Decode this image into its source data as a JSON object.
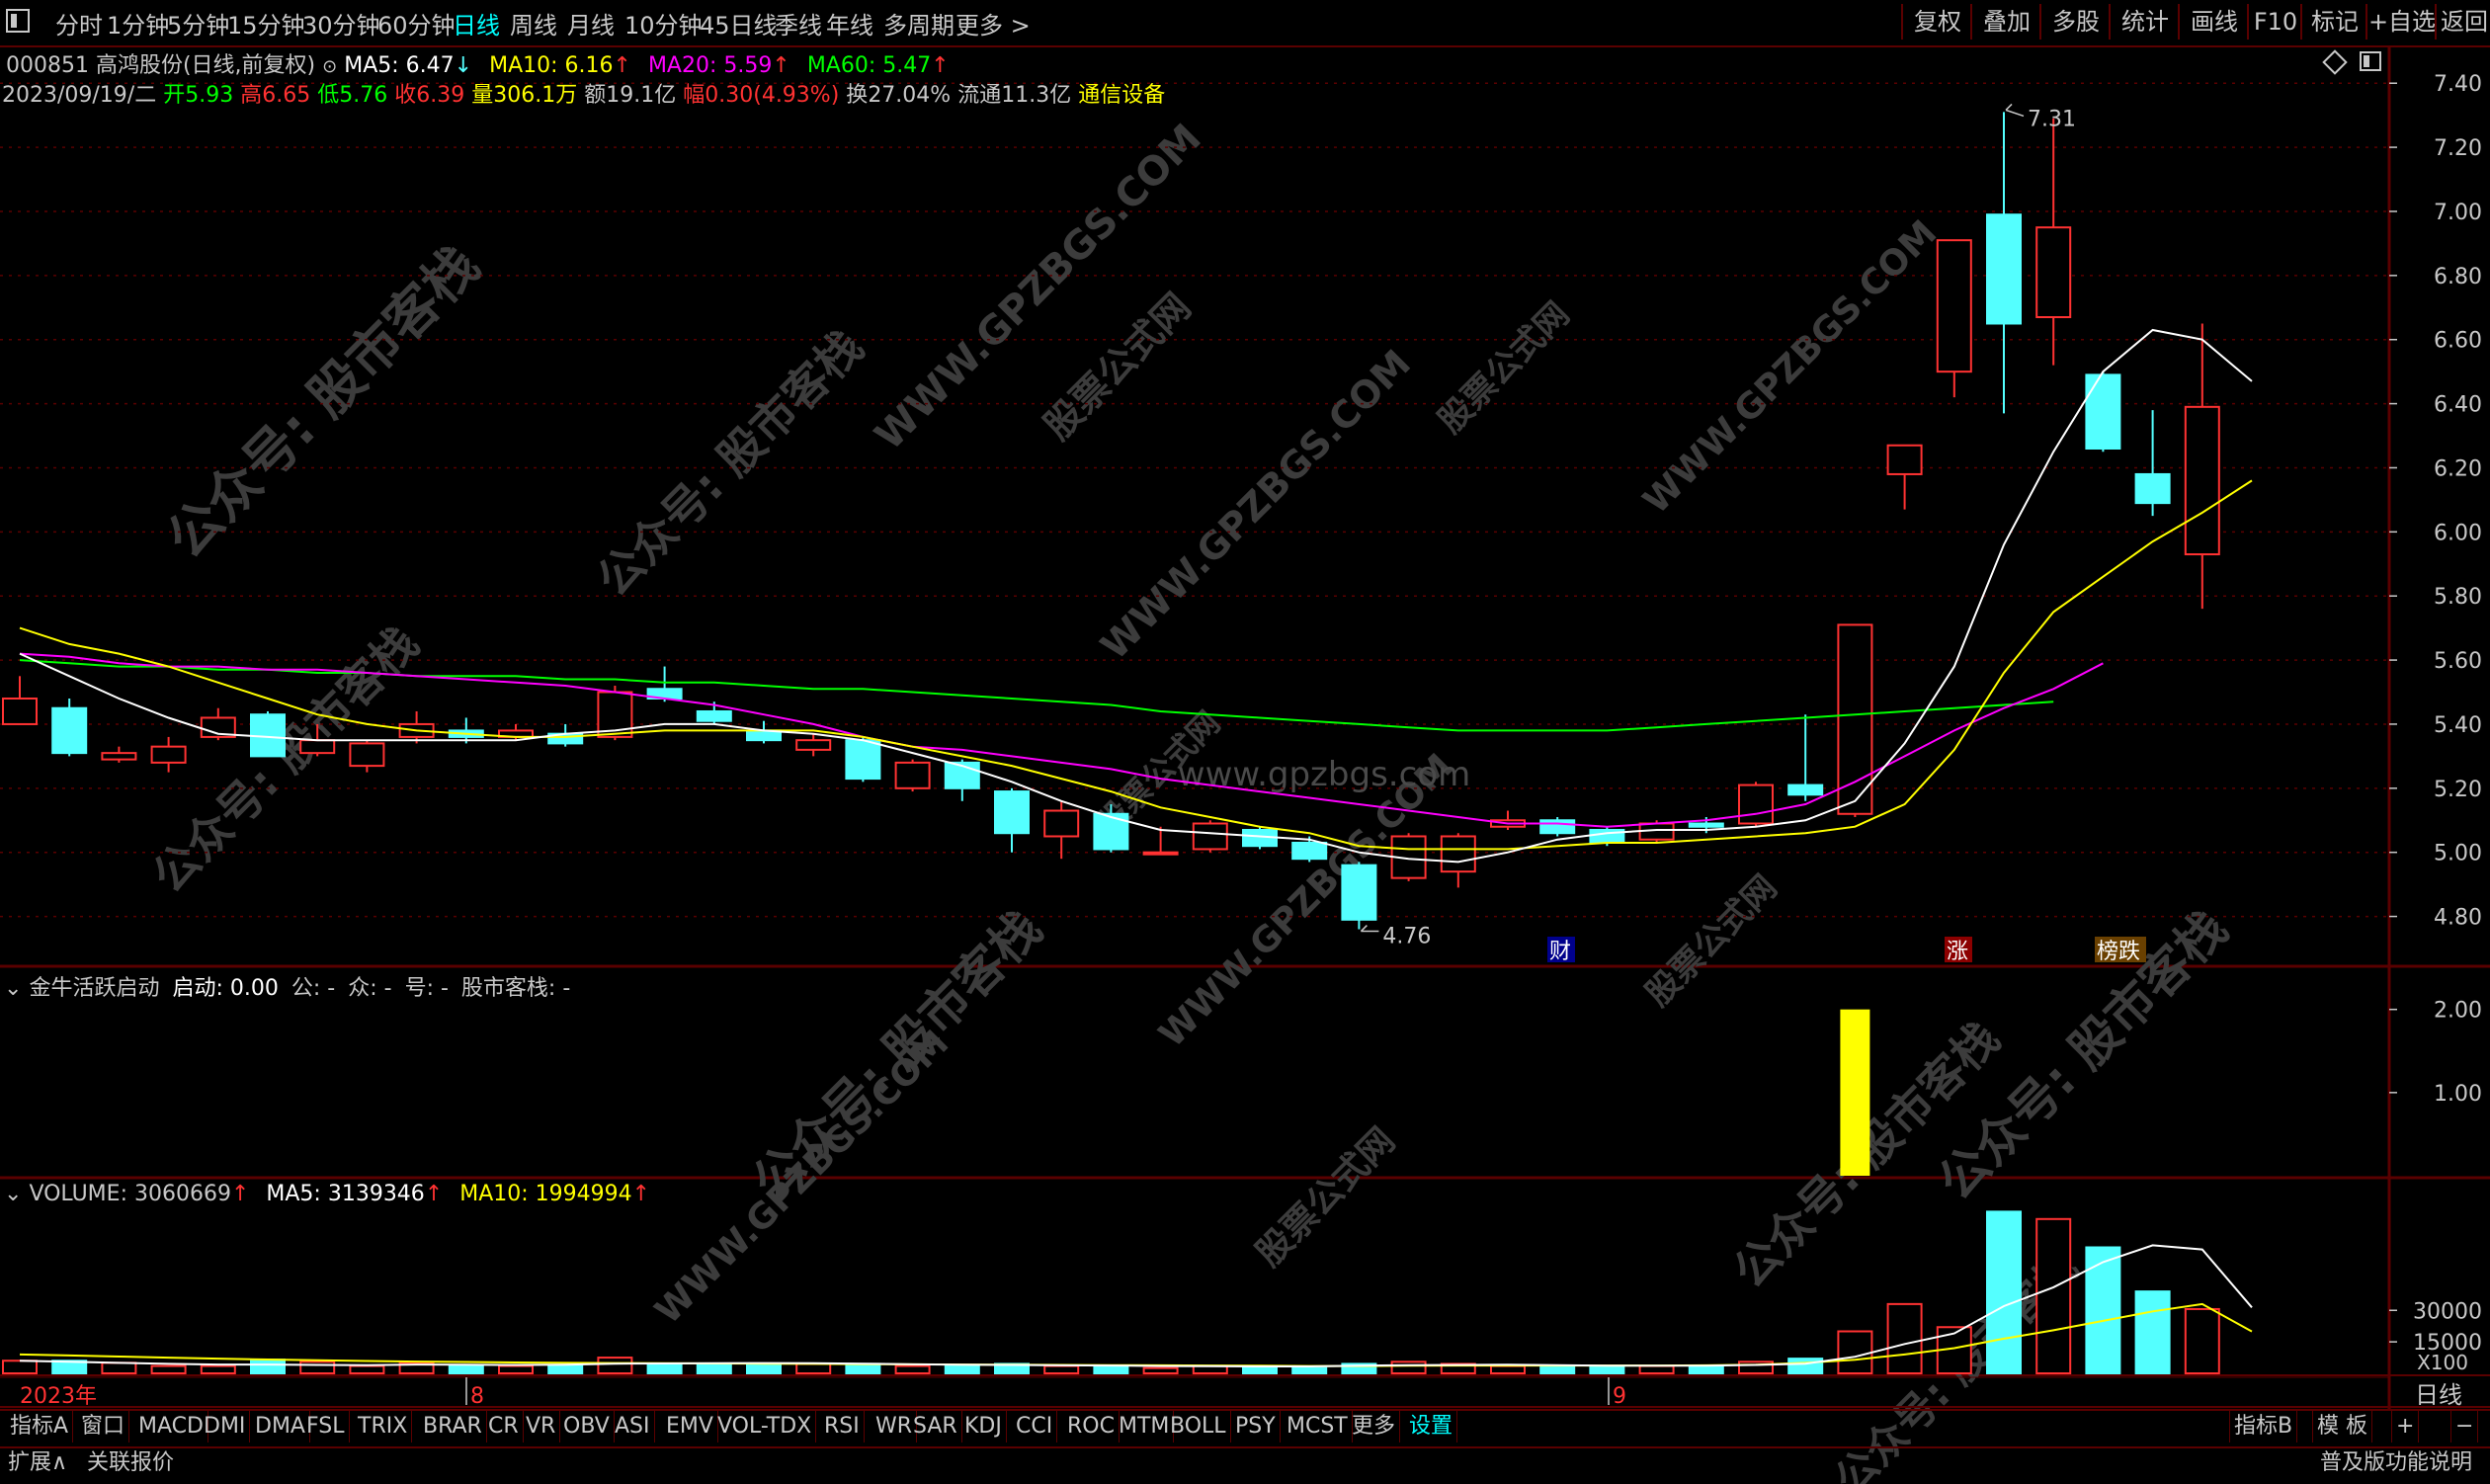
{
  "toolbar": {
    "periods": [
      "分时",
      "1分钟",
      "5分钟",
      "15分钟",
      "30分钟",
      "60分钟",
      "日线",
      "周线",
      "月线",
      "10分钟",
      "45日线",
      "季线",
      "年线",
      "多周期",
      "更多 >"
    ],
    "selected_period": "日线",
    "right_buttons": [
      "复权",
      "叠加",
      "多股",
      "统计",
      "画线",
      "F10",
      "标记",
      "+自选",
      "返回"
    ]
  },
  "header": {
    "title": "000851 高鸿股份(日线,前复权)",
    "ma5_label": "MA5: 6.47",
    "ma10_label": "MA10: 6.16",
    "ma20_label": "MA20: 5.59",
    "ma60_label": "MA60: 5.47",
    "date": "2023/09/19/二",
    "open_label": "开",
    "open": "5.93",
    "high_label": "高",
    "high": "6.65",
    "low_label": "低",
    "low": "5.76",
    "close_label": "收",
    "close": "6.39",
    "vol_label": "量",
    "vol": "306.1万",
    "amount_label": "额",
    "amount": "19.1亿",
    "range_label": "幅",
    "range": "0.30(4.93%)",
    "turnover_label": "换",
    "turnover": "27.04%",
    "float_label": "流通",
    "float": "11.3亿",
    "industry": "通信设备"
  },
  "price_axis": [
    "7.40",
    "7.20",
    "7.00",
    "6.80",
    "6.60",
    "6.40",
    "6.20",
    "6.00",
    "5.80",
    "5.60",
    "5.40",
    "5.20",
    "5.00",
    "4.80"
  ],
  "markers": {
    "high_label": "7.31",
    "low_label": "4.76",
    "m1": "财",
    "m2": "涨",
    "m3": "榜跌"
  },
  "indicator_panel": {
    "title": "金牛活跃启动",
    "field1": "启动: 0.00",
    "field2": "公: -",
    "field3": "众: -",
    "field4": "号: -",
    "field5": "股市客栈: -",
    "axis": [
      "2.00",
      "1.00"
    ]
  },
  "volume_panel": {
    "vol_label": "VOLUME: 3060669",
    "ma5_label": "MA5: 3139346",
    "ma10_label": "MA10: 1994994",
    "axis": [
      "30000",
      "15000"
    ],
    "unit": "X100"
  },
  "time_axis": {
    "labels": [
      "2023年",
      "8",
      "9"
    ],
    "right_label": "日线"
  },
  "bottom_tabs": [
    "指标A",
    "窗口",
    "MACD",
    "DMI",
    "DMA",
    "FSL",
    "TRIX",
    "BRAR",
    "CR",
    "VR",
    "OBV",
    "ASI",
    "EMV",
    "VOL-TDX",
    "RSI",
    "WR",
    "SAR",
    "KDJ",
    "CCI",
    "ROC",
    "MTM",
    "BOLL",
    "PSY",
    "MCST",
    "更多",
    "设置"
  ],
  "bottom_right": [
    "指标B",
    "模 板",
    "+",
    "−"
  ],
  "status": {
    "left1": "扩展∧",
    "left2": "关联报价",
    "right": "普及版功能说明"
  },
  "watermarks": [
    "公众号: 股市客栈",
    "WWW.GPZBGS.COM",
    "股票公式网",
    "www.gpzbgs.com"
  ],
  "colors": {
    "up": "#ff3232",
    "down": "#54ffff",
    "ma5": "#ffffff",
    "ma10": "#ffff00",
    "ma20": "#ff00ff",
    "ma60": "#00ff00",
    "grid": "#5a0000",
    "bar": "#ffff00"
  },
  "chart_data": {
    "type": "candlestick",
    "candles": [
      {
        "o": 5.4,
        "c": 5.48,
        "h": 5.55,
        "l": 5.4
      },
      {
        "o": 5.45,
        "c": 5.31,
        "h": 5.48,
        "l": 5.3
      },
      {
        "o": 5.29,
        "c": 5.31,
        "h": 5.33,
        "l": 5.28
      },
      {
        "o": 5.28,
        "c": 5.33,
        "h": 5.36,
        "l": 5.25
      },
      {
        "o": 5.36,
        "c": 5.42,
        "h": 5.45,
        "l": 5.35
      },
      {
        "o": 5.43,
        "c": 5.3,
        "h": 5.44,
        "l": 5.3
      },
      {
        "o": 5.31,
        "c": 5.35,
        "h": 5.4,
        "l": 5.3
      },
      {
        "o": 5.27,
        "c": 5.34,
        "h": 5.35,
        "l": 5.25
      },
      {
        "o": 5.36,
        "c": 5.4,
        "h": 5.44,
        "l": 5.34
      },
      {
        "o": 5.38,
        "c": 5.36,
        "h": 5.42,
        "l": 5.34
      },
      {
        "o": 5.36,
        "c": 5.38,
        "h": 5.4,
        "l": 5.35
      },
      {
        "o": 5.37,
        "c": 5.34,
        "h": 5.4,
        "l": 5.33
      },
      {
        "o": 5.36,
        "c": 5.5,
        "h": 5.52,
        "l": 5.35
      },
      {
        "o": 5.51,
        "c": 5.48,
        "h": 5.58,
        "l": 5.47
      },
      {
        "o": 5.44,
        "c": 5.41,
        "h": 5.47,
        "l": 5.4
      },
      {
        "o": 5.38,
        "c": 5.35,
        "h": 5.41,
        "l": 5.34
      },
      {
        "o": 5.32,
        "c": 5.35,
        "h": 5.37,
        "l": 5.3
      },
      {
        "o": 5.35,
        "c": 5.23,
        "h": 5.36,
        "l": 5.22
      },
      {
        "o": 5.2,
        "c": 5.28,
        "h": 5.29,
        "l": 5.19
      },
      {
        "o": 5.28,
        "c": 5.2,
        "h": 5.29,
        "l": 5.16
      },
      {
        "o": 5.19,
        "c": 5.06,
        "h": 5.2,
        "l": 5.0
      },
      {
        "o": 5.05,
        "c": 5.13,
        "h": 5.16,
        "l": 4.98
      },
      {
        "o": 5.12,
        "c": 5.01,
        "h": 5.15,
        "l": 5.0
      },
      {
        "o": 5.0,
        "c": 5.0,
        "h": 5.08,
        "l": 5.0
      },
      {
        "o": 5.01,
        "c": 5.09,
        "h": 5.1,
        "l": 5.0
      },
      {
        "o": 5.07,
        "c": 5.02,
        "h": 5.08,
        "l": 5.01
      },
      {
        "o": 5.03,
        "c": 4.98,
        "h": 5.05,
        "l": 4.97
      },
      {
        "o": 4.96,
        "c": 4.79,
        "h": 4.97,
        "l": 4.76
      },
      {
        "o": 4.92,
        "c": 5.05,
        "h": 5.06,
        "l": 4.91
      },
      {
        "o": 4.94,
        "c": 5.05,
        "h": 5.06,
        "l": 4.89
      },
      {
        "o": 5.08,
        "c": 5.1,
        "h": 5.13,
        "l": 5.07
      },
      {
        "o": 5.1,
        "c": 5.06,
        "h": 5.11,
        "l": 5.05
      },
      {
        "o": 5.07,
        "c": 5.03,
        "h": 5.08,
        "l": 5.02
      },
      {
        "o": 5.04,
        "c": 5.09,
        "h": 5.1,
        "l": 5.03
      },
      {
        "o": 5.09,
        "c": 5.08,
        "h": 5.11,
        "l": 5.06
      },
      {
        "o": 5.09,
        "c": 5.21,
        "h": 5.22,
        "l": 5.08
      },
      {
        "o": 5.21,
        "c": 5.18,
        "h": 5.43,
        "l": 5.16
      },
      {
        "o": 5.12,
        "c": 5.71,
        "h": 5.71,
        "l": 5.11
      },
      {
        "o": 6.18,
        "c": 6.27,
        "h": 6.27,
        "l": 6.07
      },
      {
        "o": 6.5,
        "c": 6.91,
        "h": 6.91,
        "l": 6.42
      },
      {
        "o": 6.99,
        "c": 6.65,
        "h": 7.31,
        "l": 6.37
      },
      {
        "o": 6.67,
        "c": 6.95,
        "h": 7.29,
        "l": 6.52
      },
      {
        "o": 6.49,
        "c": 6.26,
        "h": 6.5,
        "l": 6.25
      },
      {
        "o": 6.18,
        "c": 6.09,
        "h": 6.38,
        "l": 6.05
      },
      {
        "o": 5.93,
        "c": 6.39,
        "h": 6.65,
        "l": 5.76
      }
    ],
    "ma5": [
      5.62,
      5.55,
      5.48,
      5.42,
      5.37,
      5.36,
      5.35,
      5.35,
      5.35,
      5.35,
      5.35,
      5.37,
      5.38,
      5.4,
      5.4,
      5.38,
      5.37,
      5.35,
      5.31,
      5.27,
      5.22,
      5.16,
      5.11,
      5.07,
      5.06,
      5.05,
      5.04,
      5.0,
      4.98,
      4.97,
      5.0,
      5.04,
      5.06,
      5.07,
      5.07,
      5.08,
      5.1,
      5.16,
      5.34,
      5.58,
      5.96,
      6.25,
      6.5,
      6.63,
      6.6,
      6.47
    ],
    "ma10": [
      5.7,
      5.65,
      5.62,
      5.58,
      5.53,
      5.48,
      5.43,
      5.4,
      5.38,
      5.37,
      5.36,
      5.36,
      5.37,
      5.38,
      5.38,
      5.38,
      5.38,
      5.36,
      5.33,
      5.3,
      5.27,
      5.23,
      5.19,
      5.14,
      5.11,
      5.08,
      5.06,
      5.02,
      5.01,
      5.01,
      5.01,
      5.02,
      5.03,
      5.03,
      5.04,
      5.05,
      5.06,
      5.08,
      5.15,
      5.32,
      5.56,
      5.75,
      5.86,
      5.97,
      6.06,
      6.16
    ],
    "ma20": [
      5.62,
      5.61,
      5.59,
      5.58,
      5.58,
      5.57,
      5.57,
      5.56,
      5.55,
      5.54,
      5.53,
      5.52,
      5.5,
      5.48,
      5.46,
      5.43,
      5.4,
      5.36,
      5.33,
      5.32,
      5.3,
      5.28,
      5.26,
      5.23,
      5.21,
      5.19,
      5.17,
      5.15,
      5.13,
      5.11,
      5.09,
      5.09,
      5.08,
      5.09,
      5.1,
      5.12,
      5.15,
      5.22,
      5.3,
      5.38,
      5.45,
      5.51,
      5.59
    ],
    "ma60": [
      5.6,
      5.59,
      5.58,
      5.58,
      5.57,
      5.57,
      5.56,
      5.56,
      5.55,
      5.55,
      5.55,
      5.54,
      5.54,
      5.53,
      5.53,
      5.52,
      5.51,
      5.51,
      5.5,
      5.49,
      5.48,
      5.47,
      5.46,
      5.44,
      5.43,
      5.42,
      5.41,
      5.4,
      5.39,
      5.38,
      5.38,
      5.38,
      5.38,
      5.39,
      5.4,
      5.41,
      5.42,
      5.43,
      5.44,
      5.45,
      5.46,
      5.47
    ],
    "indicator": {
      "index": 37,
      "value": 2.0
    },
    "volume": [
      6000,
      6000,
      5000,
      3500,
      3500,
      6500,
      5500,
      3500,
      5000,
      3500,
      3500,
      3500,
      7500,
      4000,
      4500,
      4500,
      4500,
      4500,
      3500,
      3500,
      4500,
      3500,
      3500,
      2500,
      3500,
      3000,
      2500,
      4500,
      5500,
      4500,
      3500,
      3000,
      3000,
      3500,
      3500,
      5500,
      7000,
      20000,
      33000,
      22000,
      77000,
      73500,
      60000,
      39000,
      30606
    ],
    "vol_ma5": [
      6000,
      5500,
      5000,
      4500,
      4200,
      4200,
      4000,
      3900,
      4200,
      4100,
      4000,
      4100,
      4600,
      4700,
      4800,
      4900,
      4800,
      4600,
      4300,
      4100,
      4000,
      3800,
      3700,
      3500,
      3400,
      3300,
      3300,
      3600,
      3900,
      4000,
      4100,
      3900,
      3600,
      3600,
      3600,
      4000,
      4600,
      7900,
      14000,
      19000,
      32000,
      41000,
      53000,
      61000,
      59000,
      31393
    ],
    "vol_ma10": [
      9000,
      8500,
      8000,
      7500,
      7000,
      6600,
      6200,
      5900,
      5600,
      5400,
      5200,
      5000,
      4900,
      4800,
      4700,
      4600,
      4500,
      4400,
      4300,
      4200,
      4100,
      4000,
      3900,
      3800,
      3700,
      3600,
      3500,
      3500,
      3600,
      3700,
      3700,
      3700,
      3700,
      3700,
      3800,
      4100,
      5000,
      6500,
      9000,
      12000,
      16500,
      20500,
      25000,
      29500,
      33000,
      19949
    ],
    "price_range": [
      4.7,
      7.45
    ],
    "indicator_range": [
      0,
      2.4
    ],
    "volume_range": [
      0,
      80000
    ]
  }
}
